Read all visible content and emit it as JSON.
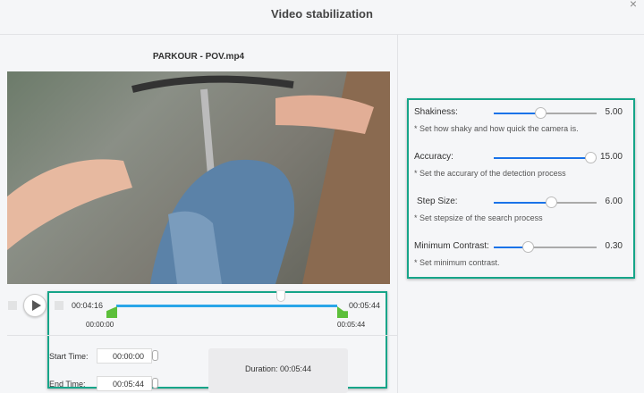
{
  "window": {
    "title": "Video stabilization",
    "close_icon": "×"
  },
  "preview": {
    "filename": "PARKOUR - POV.mp4"
  },
  "timeline": {
    "current_time": "00:04:16",
    "end_time": "00:05:44",
    "start_marker": "00:00:00",
    "end_marker": "00:05:44"
  },
  "trim": {
    "start_label": "Start Time:",
    "start_value": "00:00:00",
    "end_label": "End Time:",
    "end_value": "00:05:44",
    "duration_label": "Duration:",
    "duration_value": "00:05:44"
  },
  "settings": [
    {
      "label": "Shakiness:",
      "value": "5.00",
      "fraction": 0.45,
      "desc": "* Set how shaky and how quick the camera is."
    },
    {
      "label": "Accuracy:",
      "value": "15.00",
      "fraction": 0.94,
      "desc": "* Set the accurary of the detection process"
    },
    {
      "label": "Step Size:",
      "value": "6.00",
      "fraction": 0.56,
      "desc": "* Set stepsize of the search process"
    },
    {
      "label": "Minimum Contrast:",
      "value": "0.30",
      "fraction": 0.33,
      "desc": "* Set minimum contrast."
    }
  ],
  "colors": {
    "highlight": "#16a589",
    "slider": "#1a73e8",
    "range": "#2aa6e8",
    "marker": "#5cbf3a"
  }
}
